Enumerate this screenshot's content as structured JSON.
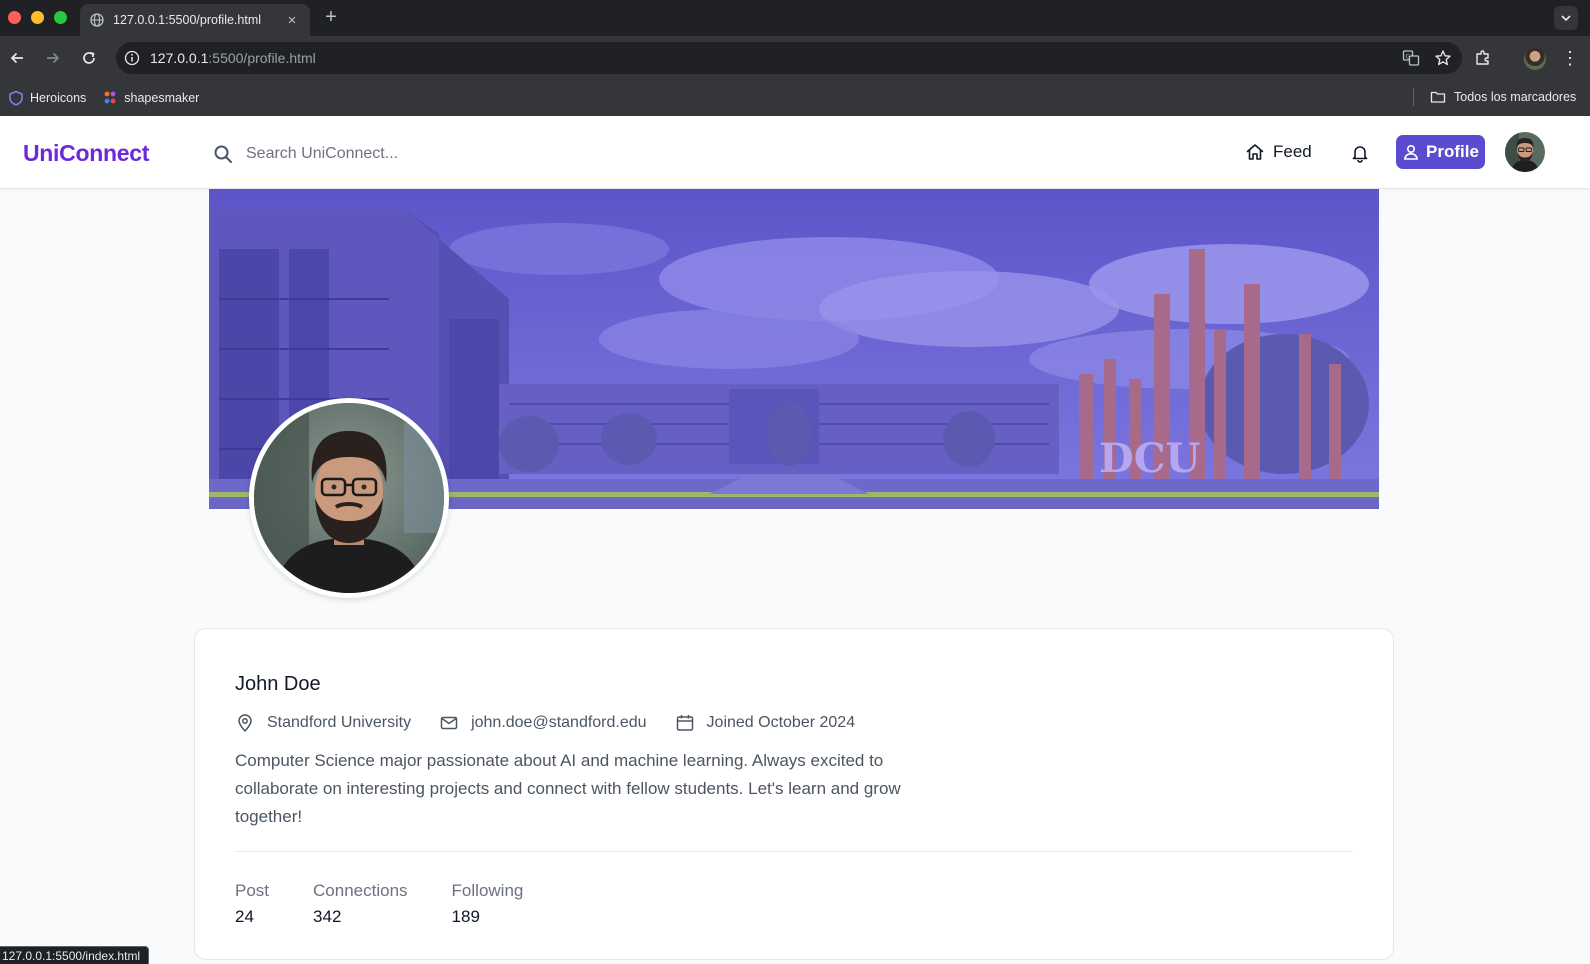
{
  "browser": {
    "tab_title": "127.0.0.1:5500/profile.html",
    "tab_close": "×",
    "new_tab": "+",
    "url_host": "127.0.0.1",
    "url_path": ":5500/profile.html",
    "menu": "⋮",
    "bookmarks": [
      {
        "label": "Heroicons",
        "icon": "shield-icon"
      },
      {
        "label": "shapesmaker",
        "icon": "dots-icon"
      }
    ],
    "all_bookmarks": "Todos los marcadores",
    "status_url": "127.0.0.1:5500/index.html"
  },
  "app": {
    "logo": "UniConnect",
    "search_placeholder": "Search UniConnect...",
    "nav_feed": "Feed",
    "nav_profile": "Profile",
    "accent_color": "#5b4bcf",
    "logo_color": "#6d28d9"
  },
  "banner": {
    "sign_text": "DCU"
  },
  "profile": {
    "name": "John Doe",
    "university": "Standford University",
    "email": "john.doe@standford.edu",
    "joined": "Joined October 2024",
    "bio": "Computer Science major passionate about AI and machine learning. Always excited to collaborate on interesting projects and connect with fellow students. Let's learn and grow together!",
    "stats": [
      {
        "label": "Post",
        "value": "24"
      },
      {
        "label": "Connections",
        "value": "342"
      },
      {
        "label": "Following",
        "value": "189"
      }
    ]
  }
}
